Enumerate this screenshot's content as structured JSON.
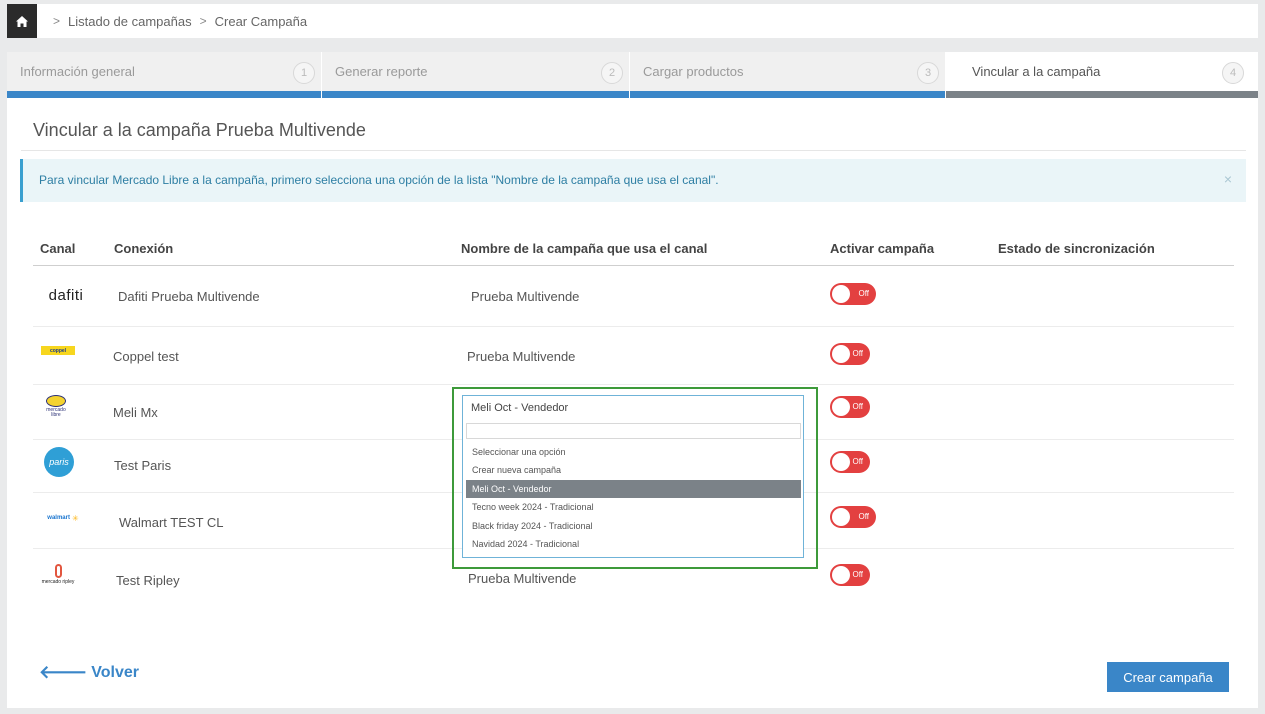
{
  "breadcrumb": {
    "items": [
      "Listado de campañas",
      "Crear Campaña"
    ]
  },
  "steps": [
    {
      "label": "Información general",
      "num": "1"
    },
    {
      "label": "Generar reporte",
      "num": "2"
    },
    {
      "label": "Cargar productos",
      "num": "3"
    },
    {
      "label": "Vincular a la campaña",
      "num": "4"
    }
  ],
  "page": {
    "title": "Vincular a la campaña Prueba Multivende"
  },
  "alert": {
    "text": "Para vincular Mercado Libre a la campaña, primero selecciona una opción de la lista \"Nombre de la campaña que usa el canal\".",
    "close": "×"
  },
  "table": {
    "headers": {
      "canal": "Canal",
      "conexion": "Conexión",
      "nombre": "Nombre de la campaña que usa el canal",
      "activar": "Activar campaña",
      "estado": "Estado de sincronización"
    },
    "rows": [
      {
        "logo": "dafiti",
        "conexion": "Dafiti Prueba Multivende",
        "campana": "Prueba Multivende",
        "toggle": "Off"
      },
      {
        "logo": "coppel",
        "conexion": "Coppel test",
        "campana": "Prueba Multivende",
        "toggle": "Off"
      },
      {
        "logo": "mercado libre",
        "conexion": "Meli Mx",
        "campana": "",
        "toggle": "Off"
      },
      {
        "logo": "paris",
        "conexion": "Test Paris",
        "campana": "",
        "toggle": "Off"
      },
      {
        "logo": "walmart",
        "conexion": "Walmart TEST CL",
        "campana": "",
        "toggle": "Off"
      },
      {
        "logo": "mercado ripley",
        "conexion": "Test Ripley",
        "campana": "Prueba Multivende",
        "toggle": "Off"
      }
    ]
  },
  "dropdown": {
    "selected": "Meli Oct - Vendedor",
    "search_value": "",
    "options": [
      "Seleccionar una opción",
      "Crear nueva campaña",
      "Meli Oct - Vendedor",
      "Tecno week 2024 - Tradicional",
      "Black friday 2024 - Tradicional",
      "Navidad 2024 - Tradicional"
    ]
  },
  "footer": {
    "back": "Volver",
    "create": "Crear campaña"
  },
  "colors": {
    "primary": "#3a86c8",
    "toggle_off": "#e34040",
    "highlight": "#3d9a3a"
  }
}
